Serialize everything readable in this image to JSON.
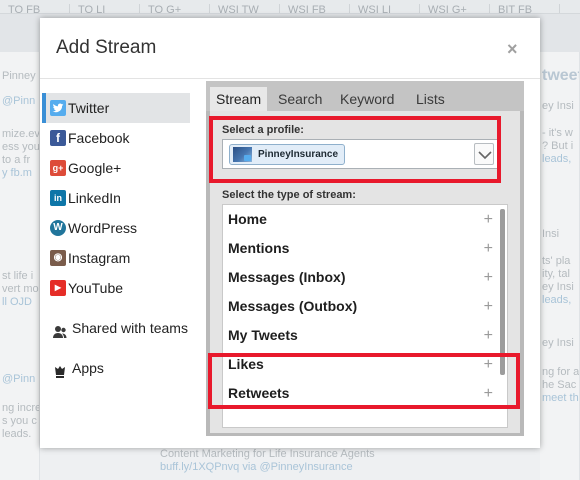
{
  "background": {
    "tabs": [
      "TO FB",
      "TO LI",
      "TO G+",
      "WSI TW",
      "WSI FB",
      "WSI LI",
      "WSI G+",
      "BIT FB"
    ],
    "left_snippets": [
      "Pinney",
      "@Pinn",
      "mize.ev",
      "ess you",
      "to a fr",
      "y fb.m",
      "st life i",
      "vert mo",
      "ll OJD",
      "@Pinn",
      "ng incre",
      "s you c",
      "leads."
    ],
    "right_snippets": [
      "tweet",
      "ey Insi",
      "- it's w",
      "? But i",
      "leads,",
      "Insi",
      "ts' pla",
      "ity, tal",
      "ey Insi",
      "leads,",
      "ey Insi",
      "ng for a",
      "he Sac",
      "meet th"
    ],
    "bottom_snippets": [
      "Content Marketing for Life Insurance Agents",
      "buff.ly/1XQPnvq via @PinneyInsurance"
    ]
  },
  "modal": {
    "title": "Add Stream",
    "close_glyph": "×"
  },
  "networks": [
    {
      "name": "twitter",
      "label": "Twitter",
      "icon": "twitter-icon",
      "color": "#55acee",
      "glyph": "t",
      "selected": true
    },
    {
      "name": "facebook",
      "label": "Facebook",
      "icon": "facebook-icon",
      "color": "#3b5998",
      "glyph": "f",
      "selected": false
    },
    {
      "name": "googleplus",
      "label": "Google+",
      "icon": "googleplus-icon",
      "color": "#dd4b39",
      "glyph": "g+",
      "selected": false
    },
    {
      "name": "linkedin",
      "label": "LinkedIn",
      "icon": "linkedin-icon",
      "color": "#0e76a8",
      "glyph": "in",
      "selected": false
    },
    {
      "name": "wordpress",
      "label": "WordPress",
      "icon": "wordpress-icon",
      "color": "#21759b",
      "glyph": "W",
      "selected": false
    },
    {
      "name": "instagram",
      "label": "Instagram",
      "icon": "instagram-icon",
      "color": "#7a5c4b",
      "glyph": "◉",
      "selected": false
    },
    {
      "name": "youtube",
      "label": "YouTube",
      "icon": "youtube-icon",
      "color": "#e52d27",
      "glyph": "▶",
      "selected": false
    }
  ],
  "extras": {
    "teams_label": "Shared with teams",
    "apps_label": "Apps"
  },
  "tabs": [
    {
      "label": "Stream",
      "active": true
    },
    {
      "label": "Search",
      "active": false
    },
    {
      "label": "Keyword",
      "active": false
    },
    {
      "label": "Lists",
      "active": false
    }
  ],
  "profile": {
    "label": "Select a profile:",
    "selected": "PinneyInsurance"
  },
  "stream_types": {
    "label": "Select the type of stream:",
    "items": [
      "Home",
      "Mentions",
      "Messages (Inbox)",
      "Messages (Outbox)",
      "My Tweets",
      "Likes",
      "Retweets"
    ],
    "add_glyph": "+"
  },
  "colors": {
    "accent_blue": "#3a8fd6",
    "highlight_red": "#e8192c",
    "panel_gray": "#b9b9b9"
  }
}
